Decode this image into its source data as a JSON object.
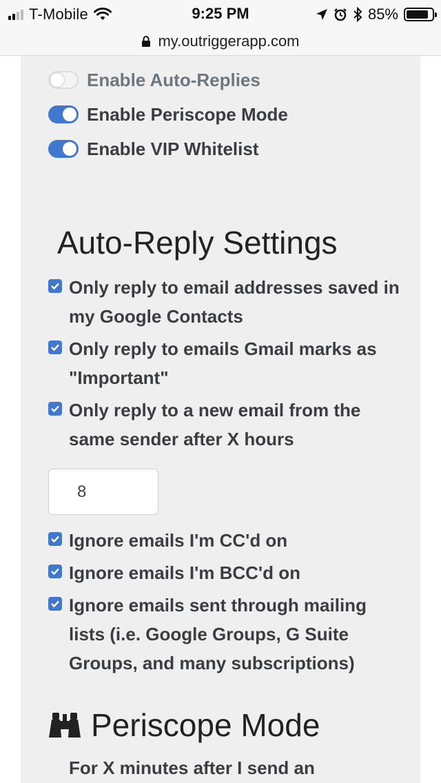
{
  "status_bar": {
    "carrier": "T-Mobile",
    "time": "9:25 PM",
    "battery_percent": "85%",
    "battery_level": 0.85,
    "signal_bars_filled": 2,
    "icons": [
      "signal-icon",
      "wifi-icon",
      "location-icon",
      "alarm-icon",
      "bluetooth-icon",
      "battery-icon"
    ]
  },
  "url_bar": {
    "url": "my.outriggerapp.com",
    "icon": "lock-icon"
  },
  "toggles": [
    {
      "label": "Enable Auto-Replies",
      "on": false
    },
    {
      "label": "Enable Periscope Mode",
      "on": true
    },
    {
      "label": "Enable VIP Whitelist",
      "on": true
    }
  ],
  "auto_reply": {
    "title": "Auto-Reply Settings",
    "options": [
      {
        "text": "Only reply to email addresses saved in my Google Contacts",
        "checked": true
      },
      {
        "text": "Only reply to emails Gmail marks as \"Important\"",
        "checked": true
      },
      {
        "text": "Only reply to a new email from the same sender after X hours",
        "checked": true
      }
    ],
    "hours_value": "8",
    "ignore_options": [
      {
        "text": "Ignore emails I'm CC'd on",
        "checked": true
      },
      {
        "text": "Ignore emails I'm BCC'd on",
        "checked": true
      },
      {
        "text": "Ignore emails sent through mailing lists (i.e. Google Groups, G Suite Groups, and many subscriptions)",
        "checked": true
      }
    ]
  },
  "periscope": {
    "title": "Periscope Mode",
    "icon": "binoculars-icon",
    "intro": "For X minutes after I send an"
  },
  "colors": {
    "accent": "#3f78cd",
    "card_bg": "#efefef",
    "text": "#3a3d41",
    "heading": "#222222"
  }
}
